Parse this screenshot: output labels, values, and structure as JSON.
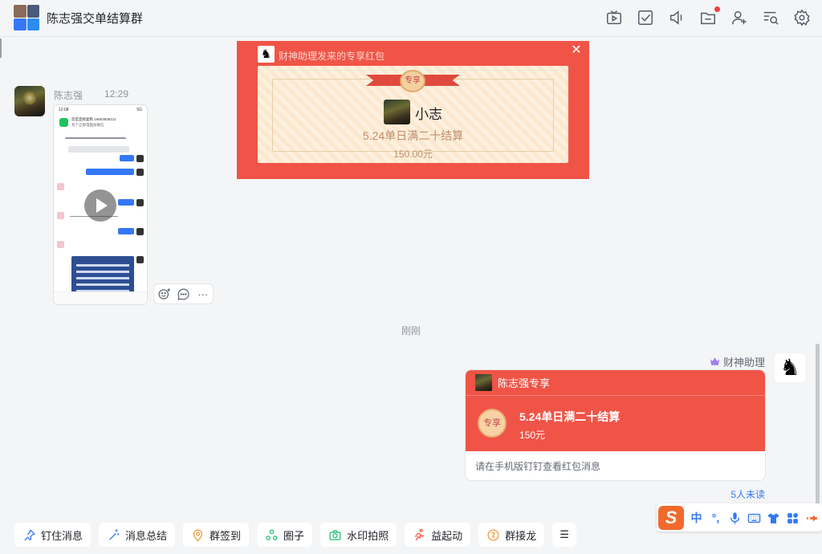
{
  "header": {
    "title": "陈志强交单结算群",
    "icons": [
      "live-icon",
      "todo-icon",
      "voice-icon",
      "folder-icon",
      "add-member-icon",
      "search-history-icon",
      "settings-icon"
    ]
  },
  "message1": {
    "sender": "陈志强",
    "time": "12:29",
    "screenshot": {
      "status_time": "12:08",
      "status_right": "5G",
      "header_line1": "您是直接复制 16603936211",
      "header_line2": "有个立即电脑加微信"
    }
  },
  "popup": {
    "title": "财神助理发来的专享红包",
    "close": "✕",
    "ribbon": "专享",
    "name": "小志",
    "description": "5.24单日满二十结算",
    "amount": "150.00元"
  },
  "divider_time": "刚刚",
  "message2": {
    "sender": "财神助理",
    "card_title": "陈志强专享",
    "seal": "专享",
    "description": "5.24单日满二十结算",
    "amount": "150元",
    "footer": "请在手机版钉钉查看红包消息",
    "unread": "5人未读"
  },
  "ime": {
    "logo": "S",
    "items": [
      "中",
      "°,",
      "mic-icon",
      "keyboard-icon",
      "shirt-icon",
      "grid-icon",
      "tool-icon"
    ]
  },
  "toolbar": {
    "buttons": [
      {
        "label": "钉住消息",
        "icon": "pin-icon"
      },
      {
        "label": "消息总结",
        "icon": "sparkle-icon"
      },
      {
        "label": "群签到",
        "icon": "location-icon"
      },
      {
        "label": "圈子",
        "icon": "circle-icon"
      },
      {
        "label": "水印拍照",
        "icon": "camera-icon"
      },
      {
        "label": "益起动",
        "icon": "run-icon"
      },
      {
        "label": "群接龙",
        "icon": "chain-icon"
      }
    ],
    "more": "☰"
  },
  "colors": {
    "red_packet": "#f05447",
    "accent_blue": "#3478f6",
    "background": "#f4f5f7"
  }
}
